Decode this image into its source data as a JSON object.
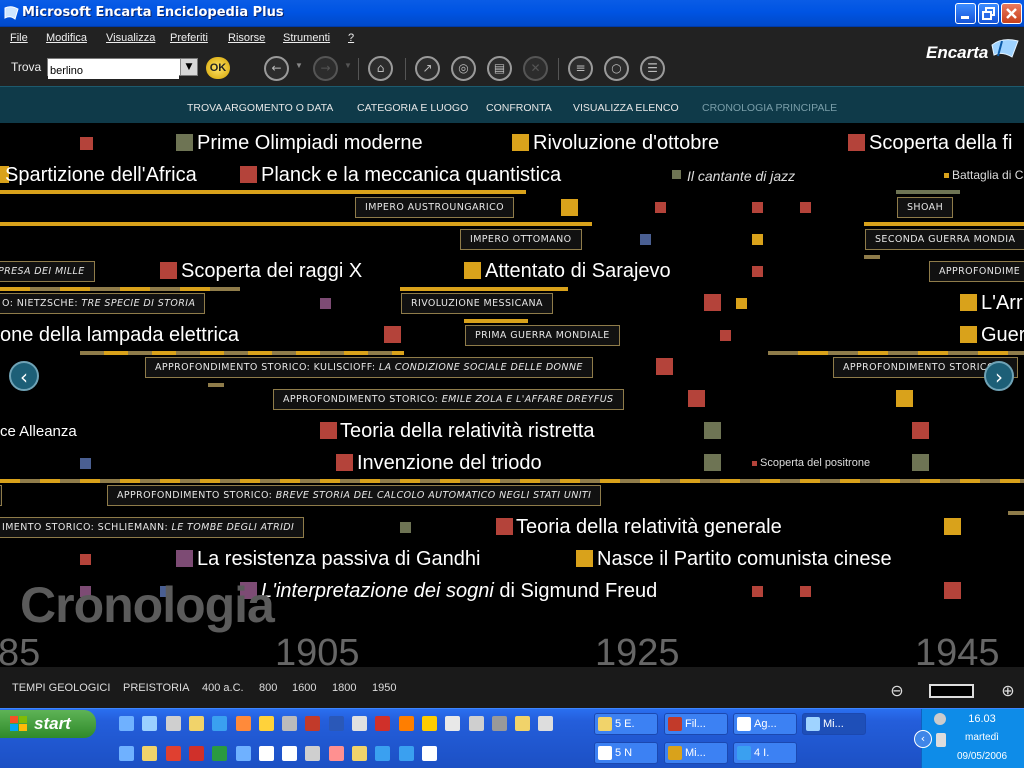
{
  "window": {
    "title": "Microsoft Encarta Enciclopedia Plus"
  },
  "menu": {
    "items": [
      "File",
      "Modifica",
      "Visualizza",
      "Preferiti",
      "Risorse",
      "Strumenti",
      "?"
    ]
  },
  "search": {
    "label": "Trova",
    "value": "berlino",
    "ok_label": "OK"
  },
  "brand": {
    "logo": "Encarta"
  },
  "nav": {
    "items": [
      "TROVA ARGOMENTO O DATA",
      "CATEGORIA E LUOGO",
      "CONFRONTA",
      "VISUALIZZA ELENCO",
      "CRONOLOGIA PRINCIPALE"
    ],
    "active_index": 4
  },
  "timeline": {
    "watermark": "Cronologia",
    "events": [
      "Prime Olimpiadi moderne",
      "Rivoluzione d'ottobre",
      "Scoperta della fi",
      "Spartizione dell'Africa",
      "Planck e la meccanica quantistica",
      "Il cantante di jazz",
      "Battaglia di Cas",
      "Scoperta dei raggi X",
      "Attentato di Sarajevo",
      "L'Arr",
      "one della lampada elettrica",
      "Guer",
      "ce Alleanza",
      "Teoria della relatività ristretta",
      "Invenzione del triodo",
      "Scoperta del positrone",
      "Teoria della relatività generale",
      "La resistenza passiva di Gandhi",
      "Nasce il Partito comunista cinese",
      "L'interpretazione dei sogni",
      " di Sigmund Freud"
    ],
    "labels": [
      "IMPERO AUSTROUNGARICO",
      "SHOAH",
      "IMPERO OTTOMANO",
      "SECONDA GUERRA MONDIA",
      "PRESA DEI MILLE",
      "APPROFONDIME",
      "O: NIETZSCHE: ",
      "TRE SPECIE DI STORIA",
      "RIVOLUZIONE MESSICANA",
      "PRIMA GUERRA MONDIALE",
      "APPROFONDIMENTO STORICO: KULISCIOFF: ",
      "LA CONDIZIONE SOCIALE DELLE DONNE",
      "APPROFONDIMENTO STORICO: S",
      "APPROFONDIMENTO STORICO: ",
      "EMILE ZOLA E L'AFFARE DREYFUS",
      "APPROFONDIMENTO STORICO: ",
      "BREVE STORIA DEL CALCOLO AUTOMATICO NEGLI STATI UNITI",
      "IMENTO STORICO: SCHLIEMANN: ",
      "LE TOMBE DEGLI ATRIDI"
    ],
    "years": [
      "85",
      "1905",
      "1925",
      "1945"
    ],
    "colors": {
      "gold": "#d9a21b",
      "red": "#b4433a",
      "olive": "#6e7454",
      "purple": "#7d4b74",
      "blue": "#4a5f92"
    }
  },
  "scale": {
    "items": [
      "TEMPI GEOLOGICI",
      "PREISTORIA",
      "400 a.C.",
      "800",
      "1600",
      "1800",
      "1950"
    ]
  },
  "taskbar": {
    "start": "start",
    "tasks_row1": [
      "5 E.",
      "Fil...",
      "Ag...",
      "Mi..."
    ],
    "tasks_row2": [
      "5 N",
      "Mi...",
      "4 I."
    ],
    "clock": {
      "time": "16.03",
      "day": "martedì",
      "date": "09/05/2006"
    }
  }
}
